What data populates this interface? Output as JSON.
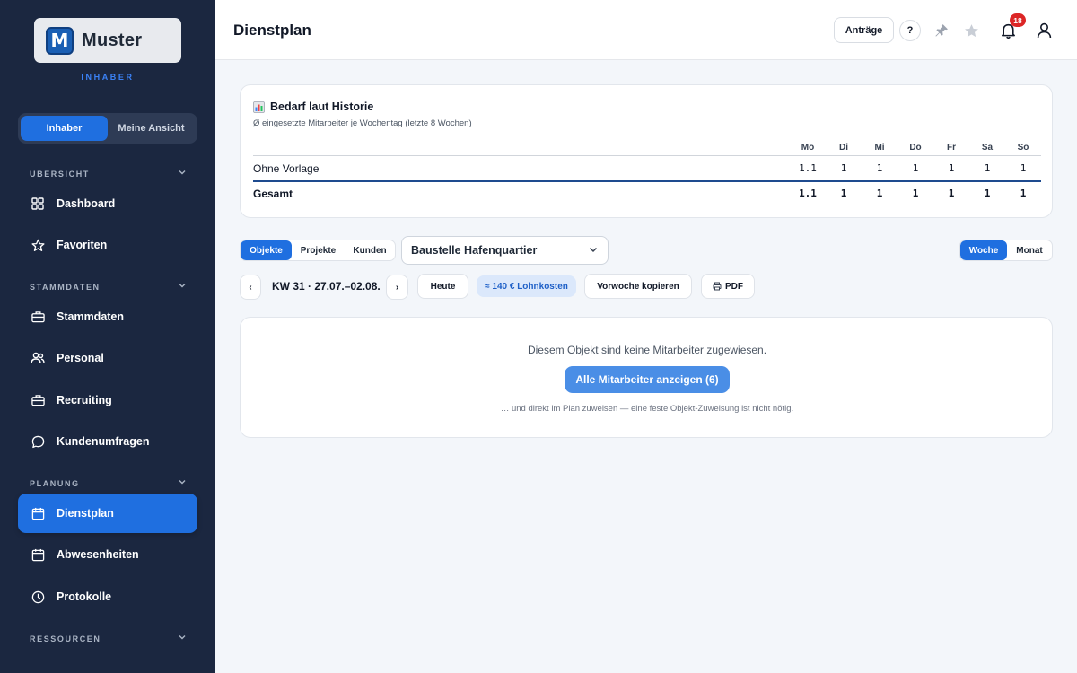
{
  "sidebar": {
    "logo_text": "Muster",
    "logo_letter": "M",
    "role": "INHABER",
    "toggle": [
      "Inhaber",
      "Meine Ansicht"
    ],
    "sections": {
      "uebersicht": "ÜBERSICHT",
      "stammdaten": "STAMMDATEN",
      "planung": "PLANUNG",
      "ressourcen": "RESSOURCEN"
    },
    "items": [
      {
        "label": "Dashboard",
        "icon": "grid-icon"
      },
      {
        "label": "Favoriten",
        "icon": "star-icon"
      },
      {
        "label": "Stammdaten",
        "icon": "briefcase-icon"
      },
      {
        "label": "Personal",
        "icon": "users-icon"
      },
      {
        "label": "Recruiting",
        "icon": "briefcase-icon"
      },
      {
        "label": "Kundenumfragen",
        "icon": "chat-icon"
      },
      {
        "label": "Dienstplan",
        "icon": "calendar-icon",
        "active": true
      },
      {
        "label": "Abwesenheiten",
        "icon": "calendar-icon"
      },
      {
        "label": "Protokolle",
        "icon": "clock-icon"
      }
    ]
  },
  "header": {
    "title": "Dienstplan",
    "antraege": "Anträge",
    "help": "?",
    "notifications": "18"
  },
  "bedarf": {
    "title": "Bedarf laut Historie",
    "subtitle": "Ø eingesetzte Mitarbeiter je Wochentag (letzte 8 Wochen)",
    "days": [
      "Mo",
      "Di",
      "Mi",
      "Do",
      "Fr",
      "Sa",
      "So"
    ],
    "rows": [
      {
        "label": "Ohne Vorlage",
        "values": [
          "1.1",
          "1",
          "1",
          "1",
          "1",
          "1",
          "1"
        ]
      },
      {
        "label": "Gesamt",
        "values": [
          "1.1",
          "1",
          "1",
          "1",
          "1",
          "1",
          "1"
        ]
      }
    ]
  },
  "controls": {
    "scope_tabs": [
      "Objekte",
      "Projekte",
      "Kunden"
    ],
    "selected_object": "Baustelle Hafenquartier",
    "view_tabs": [
      "Woche",
      "Monat"
    ],
    "prev": "‹",
    "next": "›",
    "week": "KW 31 · 27.07.–02.08.",
    "today": "Heute",
    "lohnkosten": "≈ 140 € Lohnkosten",
    "copy_week": "Vorwoche kopieren",
    "pdf": "PDF"
  },
  "empty": {
    "message": "Diesem Objekt sind keine Mitarbeiter zugewiesen.",
    "button": "Alle Mitarbeiter anzeigen (6)",
    "hint": "… und direkt im Plan zuweisen — eine feste Objekt-Zuweisung ist nicht nötig."
  },
  "colors": {
    "sidebar_bg": "#1b2740",
    "accent": "#1f6fe0",
    "badge": "#dc2626"
  }
}
